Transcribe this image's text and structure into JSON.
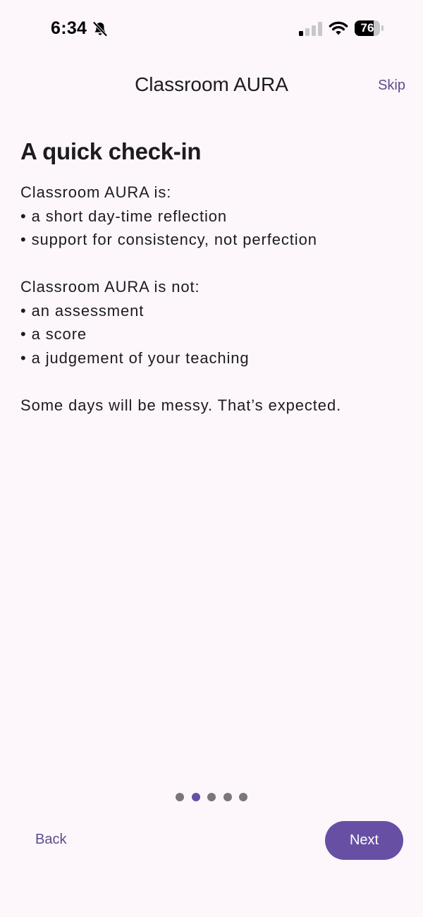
{
  "status_bar": {
    "time": "6:34",
    "battery_level": "76",
    "battery_fraction": 0.76,
    "icons": [
      "bell-slash-icon",
      "signal-icon",
      "wifi-icon",
      "battery-icon"
    ]
  },
  "app_bar": {
    "title": "Classroom AURA",
    "skip_label": "Skip"
  },
  "content": {
    "heading": "A quick check-in",
    "is_heading": "Classroom AURA is:",
    "is_items": [
      "• a short day-time reflection",
      "• support for consistency, not perfection"
    ],
    "is_not_heading": "Classroom AURA is not:",
    "is_not_items": [
      "• an assessment",
      "• a score",
      "• a judgement of your teaching"
    ],
    "closing": "Some days will be messy. That’s expected."
  },
  "pager": {
    "total": 5,
    "current": 2
  },
  "nav": {
    "back_label": "Back",
    "next_label": "Next"
  },
  "colors": {
    "background": "#FDF7FC",
    "primary": "#6750A4",
    "link": "#5E4B8B",
    "dot_inactive": "#79767D",
    "text": "#1D1B20"
  }
}
